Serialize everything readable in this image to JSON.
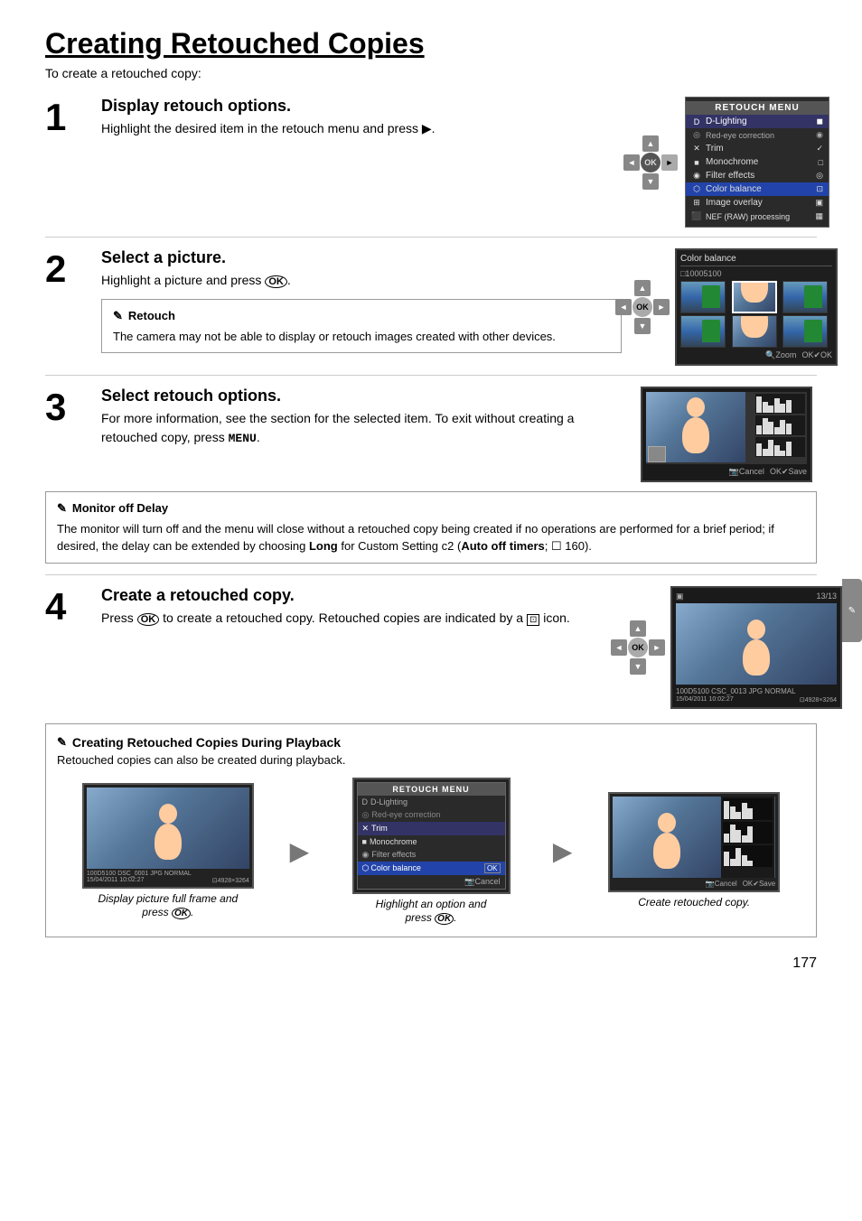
{
  "page": {
    "title": "Creating Retouched Copies",
    "intro": "To create a retouched copy:",
    "page_number": "177"
  },
  "steps": [
    {
      "number": "1",
      "title": "Display retouch options.",
      "description": "Highlight the desired item in the retouch menu and press ▶."
    },
    {
      "number": "2",
      "title": "Select a picture.",
      "description": "Highlight a picture and press ."
    },
    {
      "number": "3",
      "title": "Select retouch options.",
      "description": "For more information, see the section for the selected item.  To exit without creating a retouched copy, press MENU."
    },
    {
      "number": "4",
      "title": "Create a retouched copy.",
      "description": "Press  to create a retouched copy.  Retouched copies are indicated by a   icon."
    }
  ],
  "notes": {
    "retouch": {
      "title": "Retouch",
      "body": "The camera may not be able to display or retouch images created with other devices."
    },
    "monitor_off_delay": {
      "title": "Monitor off Delay",
      "body": "The monitor will turn off and the menu will close without a retouched copy being created if no operations are performed for a brief period; if desired, the delay can be extended by choosing Long for Custom Setting c2 (Auto off timers; ☐ 160)."
    }
  },
  "playback_section": {
    "title": "Creating Retouched Copies During Playback",
    "description": "Retouched copies can also be created during playback.",
    "steps": [
      {
        "label": "Display picture full frame and\npress ."
      },
      {
        "label": "Highlight an option and\npress ."
      },
      {
        "label": "Create retouched copy."
      }
    ]
  },
  "retouch_menu": {
    "title": "RETOUCH MENU",
    "items": [
      {
        "label": "D-Lighting",
        "icon": "D"
      },
      {
        "label": "Red-eye correction",
        "icon": "◎"
      },
      {
        "label": "Trim",
        "icon": "✕"
      },
      {
        "label": "Monochrome",
        "icon": "■"
      },
      {
        "label": "Filter effects",
        "icon": "◉"
      },
      {
        "label": "Color balance",
        "icon": "⬡"
      },
      {
        "label": "Image overlay",
        "icon": "⊞"
      },
      {
        "label": "NEF (RAW) processing",
        "icon": "🔷"
      }
    ]
  },
  "color_balance": {
    "title": "Color balance",
    "file": "□10005100"
  },
  "camera": {
    "ok_label": "OK",
    "cancel_label": "Cancel",
    "save_label": "Save",
    "zoom_label": "Zoom"
  }
}
